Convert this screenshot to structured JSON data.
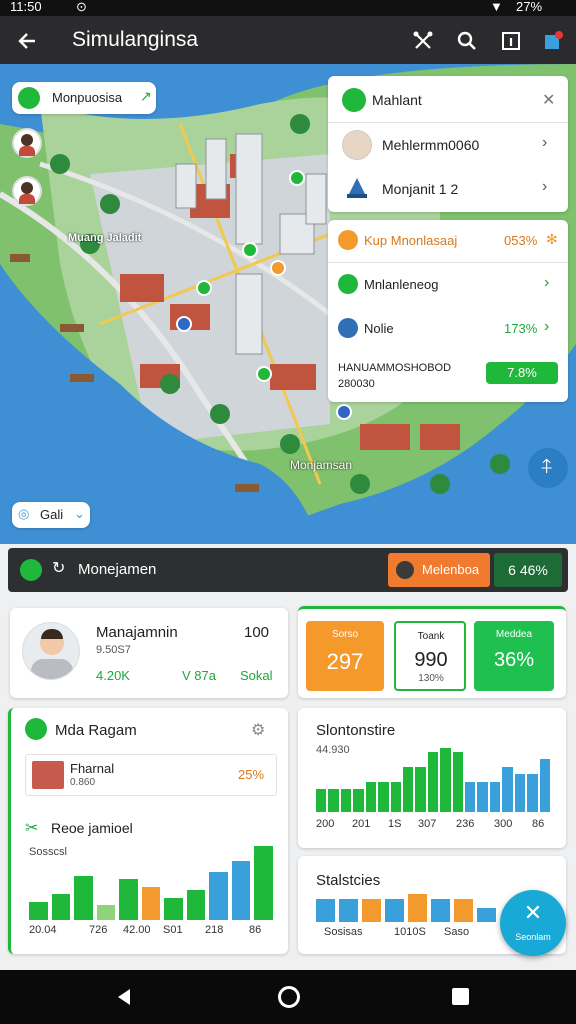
{
  "status": {
    "time": "11:50",
    "battery": "27%"
  },
  "header": {
    "title": "Simulanginsa"
  },
  "map": {
    "search_label": "Monpuosisa",
    "town_label": "Monjamsan",
    "small_label": "Gali",
    "district_label": "Muang Jaladit"
  },
  "map_panel": {
    "title": "Mahlant",
    "items": [
      {
        "label": "Mehlermm0060"
      },
      {
        "label": "Monjanit 1 2"
      }
    ]
  },
  "map_panel2": {
    "row1": {
      "label": "Kup Mnonlasaaj",
      "value": "053%"
    },
    "row2": {
      "label": "Mnlanleneog"
    },
    "row3": {
      "label": "Nolie",
      "value": "173%"
    },
    "row4": {
      "label": "HANUAMMOSHOBOD",
      "sub": "280030",
      "value": "7.8%"
    }
  },
  "mgmt": {
    "title": "Monejamen",
    "button": "Melenboa",
    "value": "6 46%"
  },
  "profile": {
    "name": "Manajamnin",
    "count": "100",
    "sub": "9.50S7",
    "stat1": "4.20K",
    "stat2": "V 87a",
    "stat3": "Sokal"
  },
  "tiles": [
    {
      "label": "Sorso",
      "value": "297"
    },
    {
      "label": "Toank",
      "value": "990",
      "sub": "130%"
    },
    {
      "label": "Meddea",
      "value": "36%"
    }
  ],
  "left_card": {
    "title": "Mda Ragam",
    "item_label": "Fharnal",
    "item_sub": "0.860",
    "item_value": "25%",
    "section": "Reoe jamioel",
    "axis_label": "Sosscsl",
    "ticks": [
      "20.04",
      "726",
      "42.00",
      "S01",
      "218",
      "86"
    ]
  },
  "chart1": {
    "title": "Slontonstire",
    "subtitle": "44.930",
    "ticks": [
      "200",
      "201",
      "1S",
      "307",
      "236",
      "300",
      "86"
    ]
  },
  "chart2": {
    "title": "Stalstcies",
    "ticks": [
      "Sosisas",
      "1010S",
      "Saso"
    ]
  },
  "fab": {
    "label": "Seonlam"
  },
  "colors": {
    "green": "#1fb83a",
    "blue": "#3aa0dc",
    "orange": "#f39a2e"
  },
  "chart_data": [
    {
      "type": "bar",
      "values": [
        5,
        7,
        12,
        4,
        11,
        9,
        6,
        8,
        13,
        16,
        20
      ],
      "colors": [
        "g",
        "g",
        "g",
        "lg",
        "g",
        "o",
        "g",
        "g",
        "b",
        "b",
        "g"
      ]
    },
    {
      "type": "bar",
      "values": [
        6,
        6,
        6,
        6,
        8,
        8,
        8,
        12,
        12,
        16,
        17,
        16,
        8,
        8,
        8,
        12,
        10,
        10,
        14
      ]
    },
    {
      "type": "bar",
      "values": [
        5,
        5,
        5,
        5,
        6,
        5,
        5,
        3
      ]
    }
  ]
}
